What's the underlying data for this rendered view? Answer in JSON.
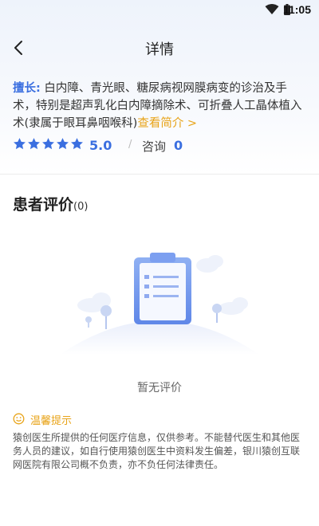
{
  "status_bar": {
    "time": "11:05"
  },
  "nav": {
    "title": "详情"
  },
  "specialty": {
    "label": "擅长:",
    "text": " 白内障、青光眼、糖尿病视网膜病变的诊治及手术，特别是超声乳化白内障摘除术、可折叠人工晶体植入术(隶属于眼耳鼻咽喉科)",
    "more_link": "查看简介 >"
  },
  "rating": {
    "stars": 5,
    "value": "5.0",
    "separator": "/",
    "consult_label": "咨询",
    "consult_count": "0"
  },
  "reviews": {
    "title": "患者评价",
    "count": "(0)",
    "empty_text": "暂无评价"
  },
  "tip": {
    "title": "温馨提示",
    "body": "猿创医生所提供的任何医疗信息，仅供参考。不能替代医生和其他医务人员的建议，如自行使用猿创医生中资料发生偏差，银川猿创互联网医院有限公司概不负责，亦不负任何法律责任。"
  },
  "colors": {
    "accent": "#3b6fe0",
    "warning": "#e8a317"
  }
}
